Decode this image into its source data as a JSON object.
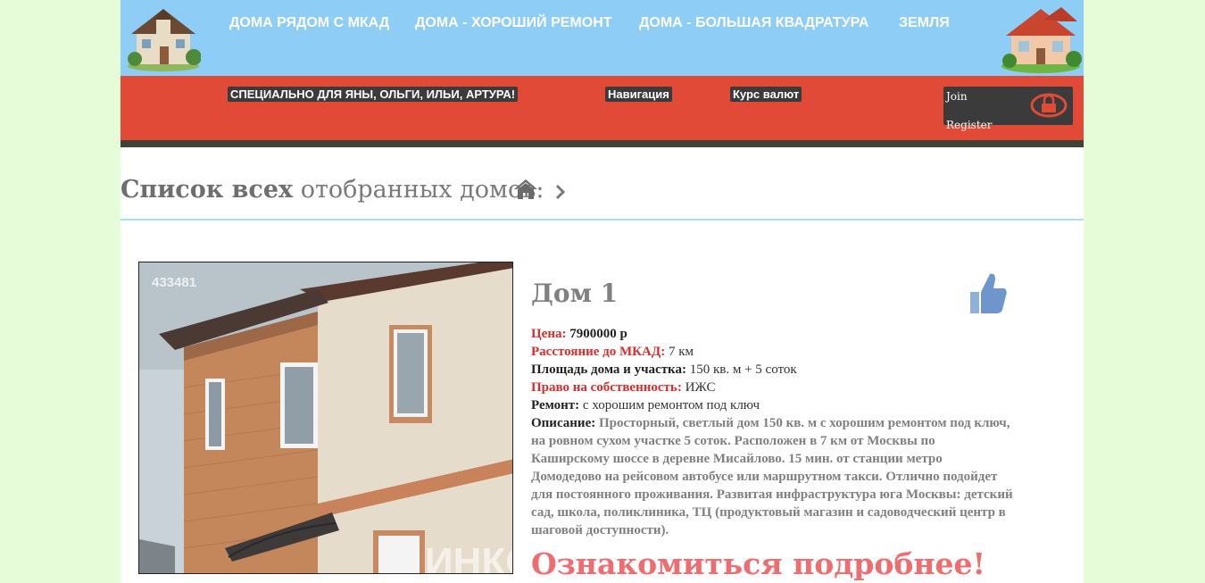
{
  "nav": {
    "items": [
      {
        "label": "ДОМА РЯДОМ С МКАД"
      },
      {
        "label": "ДОМА - ХОРОШИЙ РЕМОНТ"
      },
      {
        "label": "ДОМА - БОЛЬШАЯ КВАДРАТУРА"
      },
      {
        "label": "ЗЕМЛЯ"
      }
    ]
  },
  "subnav": {
    "special": "СПЕЦИАЛЬНО ДЛЯ ЯНЫ, ОЛЬГИ, ИЛЬИ, АРТУРА!",
    "navigation": "Навигация",
    "currency": "Курс валют",
    "join": "Join",
    "register": "Register"
  },
  "heading": {
    "bold": "Список всех",
    "rest": " отобранных домов:"
  },
  "listing": {
    "photo_id": "433481",
    "title": "Дом 1",
    "price_label": "Цена:",
    "price_value": "7900000 р",
    "distance_label": "Расстояние до МКАД:",
    "distance_value": "7 км",
    "area_label": "Площадь дома и участка:",
    "area_value": "150 кв. м + 5 соток",
    "ownership_label": "Право на собственность:",
    "ownership_value": "ИЖС",
    "repair_label": "Ремонт:",
    "repair_value": "с хорошим ремонтом под ключ",
    "description_label": "Описание:",
    "description_value": "Просторный, светлый дом 150 кв. м с хорошим ремонтом под ключ, на ровном сухом участке 5 соток. Расположен в 7 км от Москвы по Каширскому шоссе в деревне Мисайлово. 15 мин. от станции метро Домодедово на рейсовом автобусе или маршрутном такси. Отлично подойдет для постоянного проживания. Развитая инфраструктура юга Москвы: детский сад, школа, поликлиника, ТЦ (продуктовый магазин и садоводческий центр в шаговой доступности).",
    "more_link": "Ознакомиться подробнее!"
  },
  "icons": {
    "home": "home-icon",
    "chevron": "chevron-right-icon",
    "like": "thumbs-up-icon",
    "lock": "lock-icon"
  },
  "colors": {
    "topbar": "#8ecdf5",
    "redbar": "#e04a37",
    "accent_red": "#d92c2c",
    "more_link": "#ef6c6f",
    "page_bg": "#e6fbd7"
  }
}
